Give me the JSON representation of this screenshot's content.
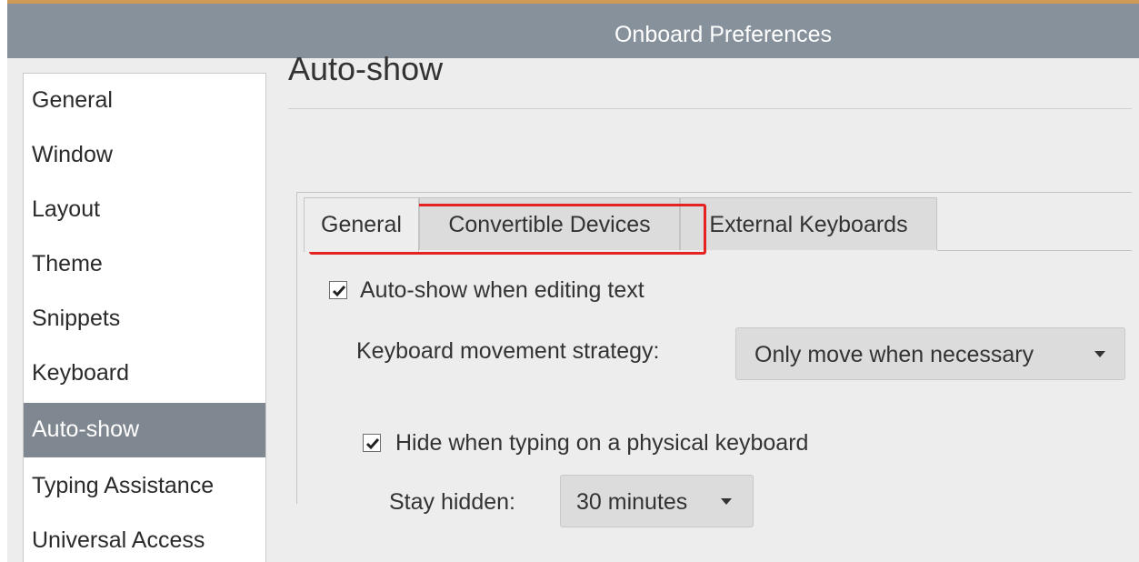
{
  "window": {
    "title": "Onboard Preferences"
  },
  "sidebar": {
    "items": [
      {
        "label": "General"
      },
      {
        "label": "Window"
      },
      {
        "label": "Layout"
      },
      {
        "label": "Theme"
      },
      {
        "label": "Snippets"
      },
      {
        "label": "Keyboard"
      },
      {
        "label": "Auto-show",
        "selected": true
      },
      {
        "label": "Typing Assistance"
      },
      {
        "label": "Universal Access"
      }
    ]
  },
  "page": {
    "title": "Auto-show"
  },
  "tabs": [
    {
      "label": "General",
      "active": true
    },
    {
      "label": "Convertible Devices"
    },
    {
      "label": "External Keyboards"
    }
  ],
  "general_tab": {
    "auto_show": {
      "label": "Auto-show when editing text",
      "checked": true
    },
    "movement_strategy": {
      "label": "Keyboard movement strategy:",
      "value": "Only move when necessary"
    },
    "hide_on_physical": {
      "label": "Hide when typing on a physical keyboard",
      "checked": true
    },
    "stay_hidden": {
      "label": "Stay hidden:",
      "value": "30 minutes"
    }
  },
  "colors": {
    "titlebar": "#87919b",
    "selected_item": "#7f8790",
    "highlight": "#e52222"
  }
}
